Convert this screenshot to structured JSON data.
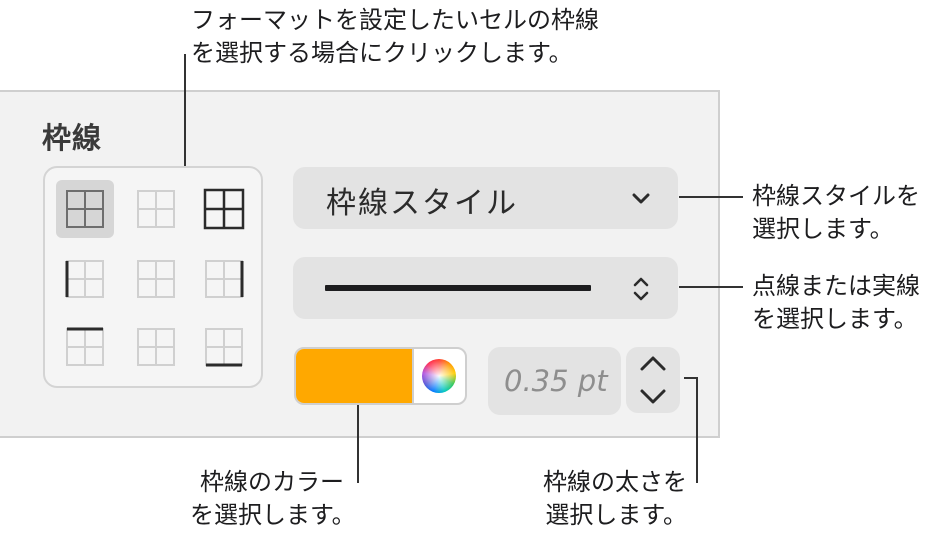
{
  "callouts": {
    "top": [
      "フォーマットを設定したいセルの枠線",
      "を選択する場合にクリックします。"
    ],
    "border_style": [
      "枠線スタイルを",
      "選択します。"
    ],
    "line_type": [
      "点線または実線",
      "を選択します。"
    ],
    "color": [
      "枠線のカラー",
      "を選択します。"
    ],
    "width": [
      "枠線の太さを",
      "選択します。"
    ]
  },
  "panel": {
    "section_title": "枠線",
    "border_style_label": "枠線スタイル",
    "border_width_value": "0.35 pt",
    "border_color": "#FFA800"
  },
  "border_grid": {
    "selected_index": 0,
    "buttons": [
      "all-borders-icon",
      "inside-borders-icon",
      "outside-borders-icon",
      "left-border-icon",
      "inside-vertical-border-icon",
      "right-border-icon",
      "top-border-icon",
      "inside-horizontal-border-icon",
      "bottom-border-icon"
    ]
  }
}
